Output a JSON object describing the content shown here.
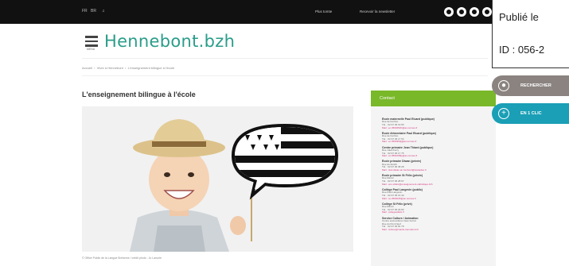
{
  "topbar": {
    "languages": [
      "FR",
      "BR"
    ],
    "links": [
      "Plus tomte",
      "Recevoir la newsletter"
    ],
    "social_icons": [
      "facebook-icon",
      "twitter-icon",
      "instagram-icon",
      "youtube-icon"
    ]
  },
  "stamp": {
    "line1": "Publié le",
    "line2": "ID : 056-2"
  },
  "header": {
    "menu_label": "MENU",
    "logo_text": "Hennebont.bzh"
  },
  "breadcrumb": [
    "Accueil",
    "Vivre à Hennebont",
    "L'enseignement bilingue à l'école"
  ],
  "page": {
    "title": "L'enseignement bilingue à l'école",
    "caption": "© Office Public de la Langue Bretonne / crédit photo : Ju Lanurie"
  },
  "contact": {
    "heading": "Contact",
    "entries": [
      {
        "name": "École maternelle Paul Eluard (publique)",
        "lines": [
          "Rue de Kerlivio",
          "Tél. : 02 97 36 19 65"
        ],
        "mail": "Mail : ec.0560352h@ac-rennes.fr"
      },
      {
        "name": "École élémentaire Paul Eluard (publique)",
        "lines": [
          "Rue de Kerlivio",
          "Tél. : 02 97 36 17 54"
        ],
        "mail": "Mail : ec.0560353j@ac-rennes.fr"
      },
      {
        "name": "Centre primaire Jean Thiard (publique)",
        "lines": [
          "Rue Jules Ferry",
          "Tél. : 02 97 36 17 75"
        ],
        "mail": "Mail : ec.0561068p@ac-rennes.fr"
      },
      {
        "name": "École primaire Diwan (privée)",
        "lines": [
          "Rue du Zénith",
          "Tél. : 02 97 36 38 28"
        ],
        "mail": "Mail : skol.diwan.an.henbont@wanadoo.fr"
      },
      {
        "name": "École primaire St Félix (privée)",
        "lines": [
          "Rue Ramiz",
          "Tél. : 02 97 36 28 67"
        ],
        "mail": "Mail : eco.stfelix@enseignement-catholique.bzh"
      },
      {
        "name": "Collège Paul Langevin (public)",
        "lines": [
          "Rue Paul Langevin",
          "Tél. : 02 97 36 15 40"
        ],
        "mail": "Mail : ce.0560045@ac-rennes.fr"
      },
      {
        "name": "Collège St Félix (privé)",
        "lines": [
          "Rue Ramiz",
          "Tél. : 02 97 36 29 83"
        ],
        "mail": "Mail : collegestfelix.fr"
      },
      {
        "name": "Service Culture / Animation",
        "lines": [
          "Centre socioculturel Jean Ferrat",
          "Rue du Pont Neuf",
          "Tél. : 02 97 36 81 78"
        ],
        "mail": "Mail : culture@mairie-hennebont.fr"
      }
    ]
  },
  "side_tabs": {
    "search_label": "RECHERCHER",
    "click_label": "EN 1 CLIC"
  },
  "colors": {
    "logo": "#2a9d8a",
    "contact_header": "#79b829",
    "search_tab": "#8a8380",
    "click_tab": "#1a9fb6",
    "link": "#d6377e"
  }
}
